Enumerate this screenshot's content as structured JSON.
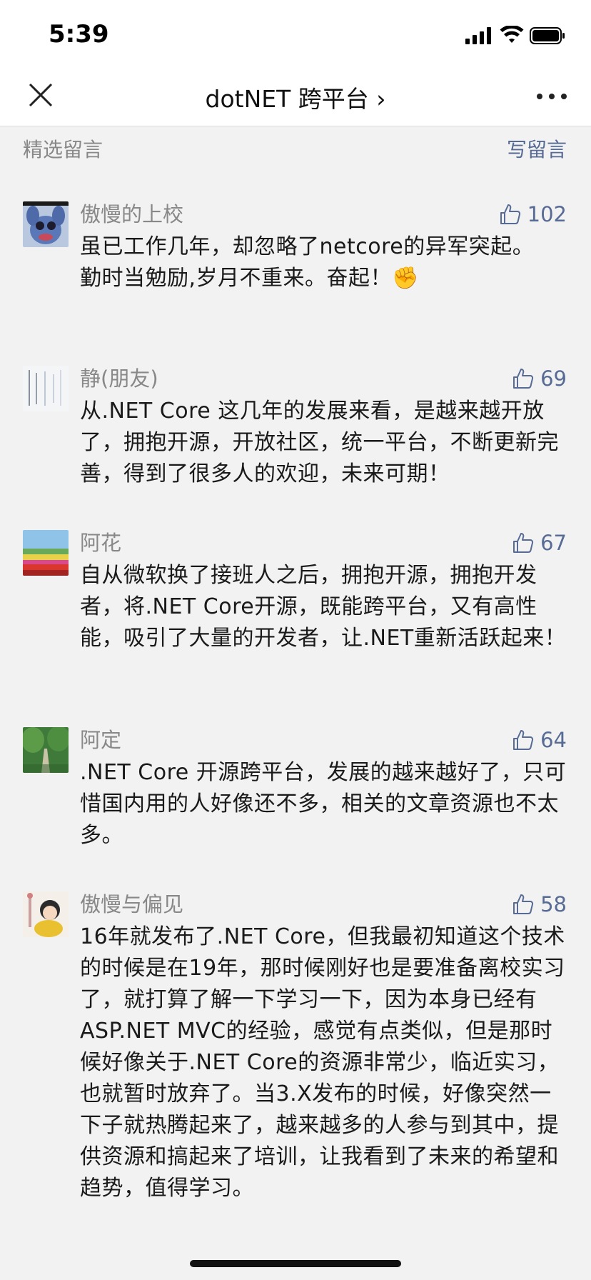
{
  "status_bar": {
    "time": "5:39"
  },
  "nav": {
    "title": "dotNET 跨平台 ›"
  },
  "section": {
    "title": "精选留言",
    "write_label": "写留言"
  },
  "comments": [
    {
      "nickname": "傲慢的上校",
      "likes": "102",
      "text_lines": [
        "虽已工作几年，却忽略了netcore的异军突起。",
        "勤时当勉励,岁月不重来。奋起！✊"
      ],
      "avatar": "stitch-avatar"
    },
    {
      "nickname": "静(朋友)",
      "likes": "69",
      "text_lines": [
        "从.NET Core 这几年的发展来看，是越来越开放了，拥抱开源，开放社区，统一平台，不断更新完善，得到了很多人的欢迎，未来可期！"
      ],
      "avatar": "calligraphy-avatar"
    },
    {
      "nickname": "阿花",
      "likes": "67",
      "text_lines": [
        "自从微软换了接班人之后，拥抱开源，拥抱开发者，将.NET Core开源，既能跨平台，又有高性能，吸引了大量的开发者，让.NET重新活跃起来！"
      ],
      "avatar": "flower-field-avatar"
    },
    {
      "nickname": "阿定",
      "likes": "64",
      "text_lines": [
        ".NET Core 开源跨平台，发展的越来越好了，只可惜国内用的人好像还不多，相关的文章资源也不太多。"
      ],
      "avatar": "forest-road-avatar"
    },
    {
      "nickname": "傲慢与偏见",
      "likes": "58",
      "text_lines": [
        "16年就发布了.NET Core，但我最初知道这个技术的时候是在19年，那时候刚好也是要准备离校实习了，就打算了解一下学习一下，因为本身已经有ASP.NET MVC的经验，感觉有点类似，但是那时候好像关于.NET Core的资源非常少，临近实习，也就暂时放弃了。当3.X发布的时候，好像突然一下子就热腾起来了，越来越多的人参与到其中，提供资源和搞起来了培训，让我看到了未来的希望和趋势，值得学习。"
      ],
      "avatar": "cartoon-girl-avatar"
    }
  ],
  "colors": {
    "accent": "#576b95",
    "background": "#f2f2f2",
    "muted_text": "#888888"
  }
}
